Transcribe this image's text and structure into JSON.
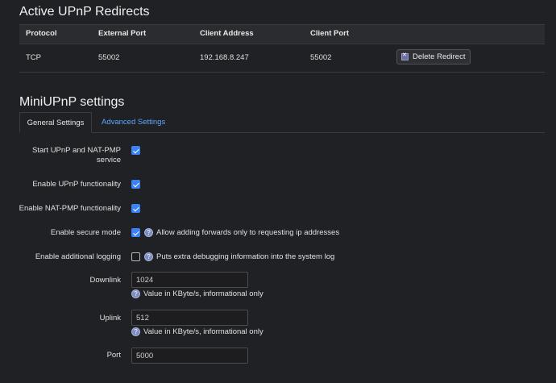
{
  "redirects": {
    "title": "Active UPnP Redirects",
    "columns": [
      "Protocol",
      "External Port",
      "Client Address",
      "Client Port"
    ],
    "rows": [
      {
        "protocol": "TCP",
        "external_port": "55002",
        "client_address": "192.168.8.247",
        "client_port": "55002",
        "action_label": "Delete Redirect"
      }
    ]
  },
  "settings": {
    "title": "MiniUPnP settings",
    "tabs": [
      {
        "label": "General Settings",
        "active": true
      },
      {
        "label": "Advanced Settings",
        "active": false
      }
    ],
    "fields": {
      "start_service": {
        "label": "Start UPnP and NAT-PMP service",
        "checked": true
      },
      "enable_upnp": {
        "label": "Enable UPnP functionality",
        "checked": true
      },
      "enable_natpmp": {
        "label": "Enable NAT-PMP functionality",
        "checked": true
      },
      "secure_mode": {
        "label": "Enable secure mode",
        "checked": true,
        "help": "Allow adding forwards only to requesting ip addresses"
      },
      "logging": {
        "label": "Enable additional logging",
        "checked": false,
        "help": "Puts extra debugging information into the system log"
      },
      "downlink": {
        "label": "Downlink",
        "value": "1024",
        "help": "Value in KByte/s, informational only"
      },
      "uplink": {
        "label": "Uplink",
        "value": "512",
        "help": "Value in KByte/s, informational only"
      },
      "port": {
        "label": "Port",
        "value": "5000"
      }
    }
  },
  "colors": {
    "accent": "#3b82f6",
    "link": "#5fa8ff",
    "background": "#202124"
  }
}
